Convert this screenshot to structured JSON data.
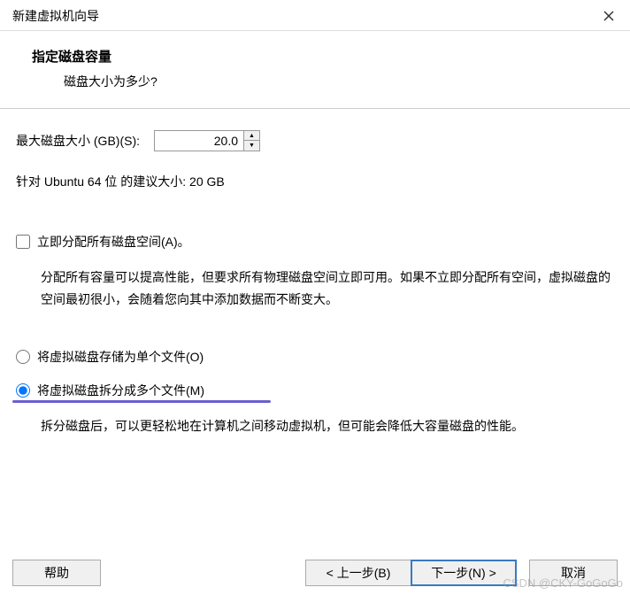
{
  "titlebar": {
    "title": "新建虚拟机向导"
  },
  "header": {
    "title": "指定磁盘容量",
    "subtitle": "磁盘大小为多少?"
  },
  "diskSize": {
    "label": "最大磁盘大小 (GB)(S):",
    "value": "20.0"
  },
  "recommendation": "针对 Ubuntu 64 位 的建议大小: 20 GB",
  "allocateNow": {
    "label": "立即分配所有磁盘空间(A)。",
    "description": "分配所有容量可以提高性能，但要求所有物理磁盘空间立即可用。如果不立即分配所有空间，虚拟磁盘的空间最初很小，会随着您向其中添加数据而不断变大。"
  },
  "storage": {
    "singleFile": "将虚拟磁盘存储为单个文件(O)",
    "multipleFiles": "将虚拟磁盘拆分成多个文件(M)",
    "multipleDescription": "拆分磁盘后，可以更轻松地在计算机之间移动虚拟机，但可能会降低大容量磁盘的性能。"
  },
  "buttons": {
    "help": "帮助",
    "back": "< 上一步(B)",
    "next": "下一步(N) >",
    "cancel": "取消"
  },
  "watermark": "CSDN @CKY-GoGoGo"
}
